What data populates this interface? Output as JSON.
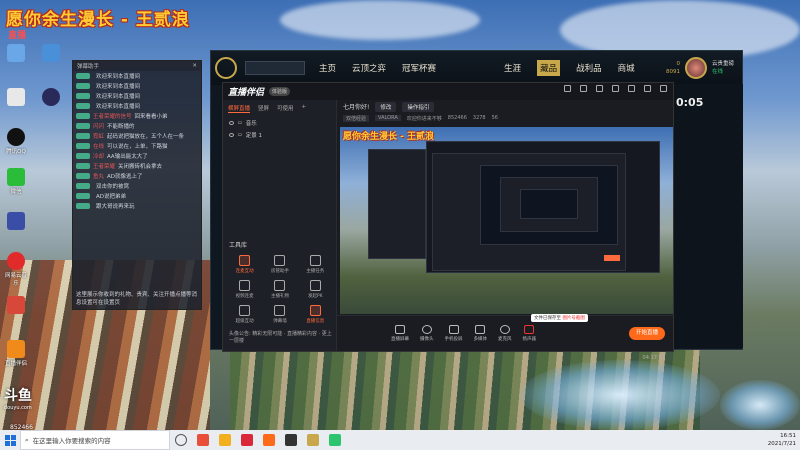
{
  "overlay": {
    "stream_title": "愿你余生漫长 - 王贰浪",
    "live_badge": "直播",
    "douyu_logo": "斗鱼",
    "douyu_sub": "douyu.com",
    "room_id": "852466"
  },
  "desktop": {
    "icons": [
      {
        "icon": "computer-icon",
        "label": ""
      },
      {
        "icon": "network-icon",
        "label": ""
      },
      {
        "icon": "recycle-bin-icon",
        "label": ""
      },
      {
        "icon": "qq-icon",
        "label": "腾讯QQ"
      },
      {
        "icon": "wechat-icon",
        "label": "微信"
      },
      {
        "icon": "app-icon",
        "label": ""
      },
      {
        "icon": "netease-music-icon",
        "label": "网易云音乐"
      },
      {
        "icon": "game-icon",
        "label": ""
      },
      {
        "icon": "helper-icon",
        "label": "直播伴侣"
      }
    ]
  },
  "chat": {
    "header": "弹幕助手",
    "lines": [
      {
        "user": "",
        "msg": "欢迎来到本直播间"
      },
      {
        "user": "",
        "msg": "欢迎来到本直播间"
      },
      {
        "user": "",
        "msg": "欢迎来到本直播间"
      },
      {
        "user": "",
        "msg": "欢迎来到本直播间"
      },
      {
        "user": "王者荣耀的信号",
        "msg": "回来看看小弟"
      },
      {
        "user": "闪闪",
        "msg": "不能断播的"
      },
      {
        "user": "霓虹",
        "msg": "起码说把猫放在，五个人在一条"
      },
      {
        "user": "在线",
        "msg": "可以说在，上单，下路猫"
      },
      {
        "user": "冷却",
        "msg": "AA输出能太大了"
      },
      {
        "user": "王者荣耀",
        "msg": "关闭搬砖机会拿去"
      },
      {
        "user": "鱼丸",
        "msg": "AD就像逃上了"
      },
      {
        "user": "",
        "msg": "双击你的被窝"
      },
      {
        "user": "",
        "msg": "AD说把弟弟"
      },
      {
        "user": "",
        "msg": "跟大哥说再来玩"
      }
    ],
    "footer": "这里展示你收到的礼物、贵宾、关注开播点播等消息设置可在设置页"
  },
  "lol": {
    "nav": [
      "主页",
      "云顶之弈",
      "冠军杯赛",
      "生涯",
      "藏品",
      "战利品",
      "商城"
    ],
    "currency_1": "0",
    "currency_2": "8091",
    "player_name": "云贵重磅",
    "status": "在线",
    "clock": "0:05"
  },
  "streamer_app": {
    "brand": "直播伴侣",
    "brand_tag": "体验版",
    "tabs": [
      "横屏直播",
      "竖屏",
      "可使用"
    ],
    "scenes": [
      "音乐",
      "定景 1"
    ],
    "tools_title": "工具库",
    "tools": [
      {
        "label": "连麦互动",
        "active": true
      },
      {
        "label": "房管助手",
        "active": false
      },
      {
        "label": "主播任务",
        "active": false
      },
      {
        "label": "视频连麦",
        "active": false
      },
      {
        "label": "主播礼物",
        "active": false
      },
      {
        "label": "发起PK",
        "active": false
      },
      {
        "label": "超级互动",
        "active": false
      },
      {
        "label": "弹幕墙",
        "active": false
      },
      {
        "label": "直播信息",
        "active": true
      }
    ],
    "notice": "头像公告: 精彩无限可能 · 直播精彩内容 · 更上一层楼",
    "room_title": "七月你好!",
    "room_btn": "修改",
    "room_btn2": "操作指引",
    "stats": [
      "双倍经验",
      "VALORA",
      "欢迎你进来不够",
      "852466",
      "3278",
      "56"
    ],
    "bottom": [
      "直播屏幕",
      "摄像头",
      "手机投屏",
      "多媒体",
      "麦克风",
      "扬声器"
    ],
    "tooltip": "文件已保存至",
    "tooltip_red": "图片号截图",
    "start_label": "开始直播",
    "timer": "04:17:03",
    "footer_left": "帧率 FPS/60fps",
    "footer_mid": "码率 9000kbps"
  },
  "taskbar": {
    "search_placeholder": "在这里输入你要搜索的内容",
    "time": "16:51",
    "date": "2021/7/21"
  }
}
